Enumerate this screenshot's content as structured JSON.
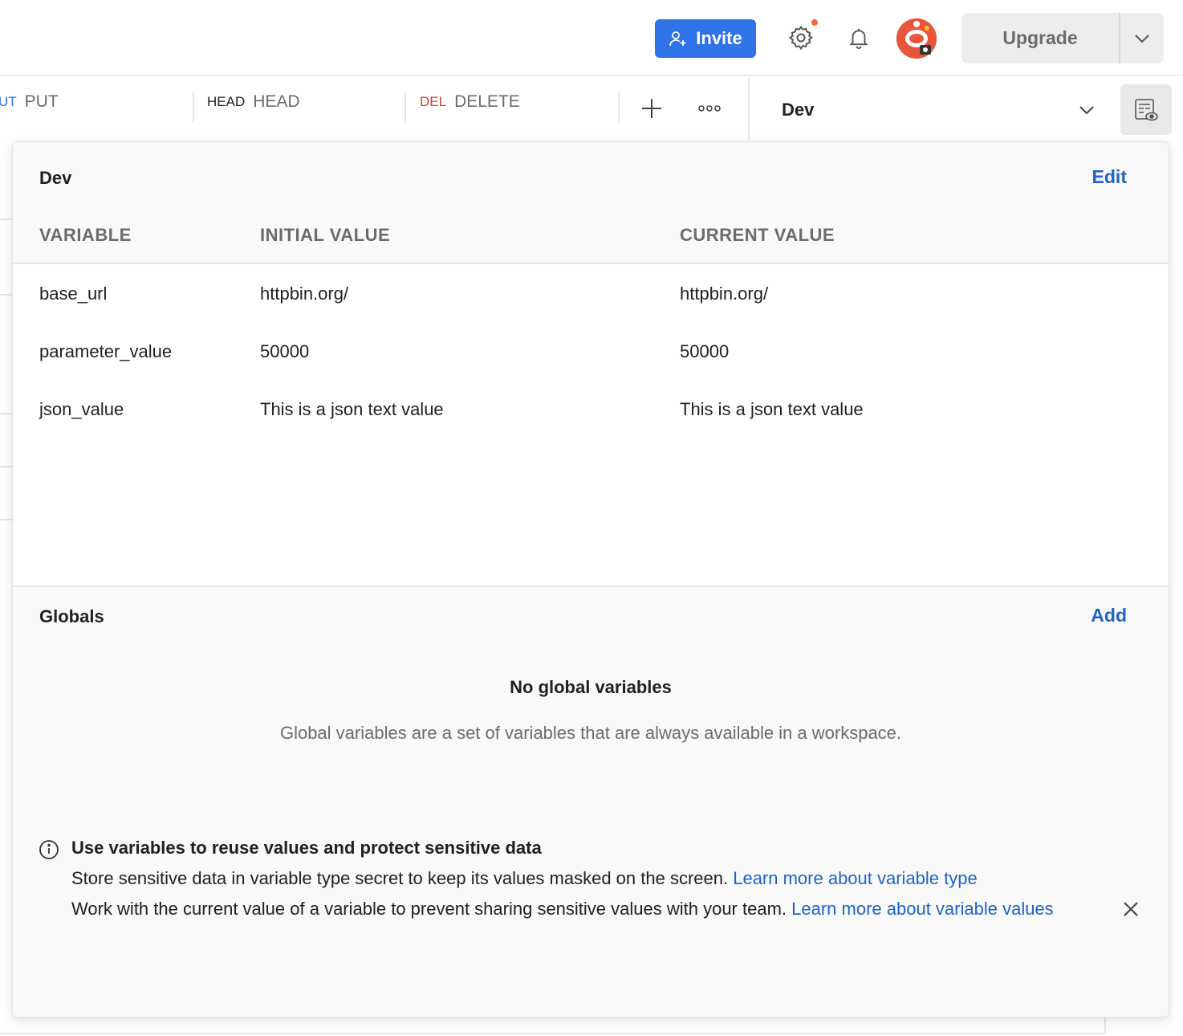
{
  "header": {
    "invite_label": "Invite",
    "upgrade_label": "Upgrade",
    "colors": {
      "accent": "#2f73e8",
      "notification_dot": "#f26b3a",
      "avatar": "#e8553a"
    }
  },
  "tabs": [
    {
      "method": "PUT",
      "method_partial": "UT",
      "name": "PUT",
      "method_color": "#2f73e8"
    },
    {
      "method": "HEAD",
      "name": "HEAD",
      "method_color": "#212121"
    },
    {
      "method": "DEL",
      "name": "DELETE",
      "method_color": "#d8392b"
    }
  ],
  "environment_selector": {
    "selected": "Dev"
  },
  "env_panel": {
    "title": "Dev",
    "edit_label": "Edit",
    "columns": [
      "VARIABLE",
      "INITIAL VALUE",
      "CURRENT VALUE"
    ],
    "rows": [
      {
        "variable": "base_url",
        "initial": "httpbin.org/",
        "current": "httpbin.org/"
      },
      {
        "variable": "parameter_value",
        "initial": "50000",
        "current": "50000"
      },
      {
        "variable": "json_value",
        "initial": "This is a json text value",
        "current": "This is a json text value"
      }
    ]
  },
  "globals": {
    "title": "Globals",
    "add_label": "Add",
    "empty_title": "No global variables",
    "empty_desc": "Global variables are a set of variables that are always available in a workspace."
  },
  "info": {
    "heading": "Use variables to reuse values and protect sensitive data",
    "line1": "Store sensitive data in variable type secret to keep its values masked on the screen. ",
    "link1": "Learn more about variable type",
    "line2": "Work with the current value of a variable to prevent sharing sensitive values with your team. ",
    "link2": "Learn more about variable values"
  },
  "icons": {
    "invite": "add-user-icon",
    "settings": "gear-icon",
    "notifications": "bell-icon",
    "upgrade_caret": "chevron-down-icon",
    "new_tab": "plus-icon",
    "more": "more-horizontal-icon",
    "env_dropdown": "chevron-down-icon",
    "quick_look": "eye-table-icon",
    "info": "info-icon",
    "close": "close-icon"
  }
}
